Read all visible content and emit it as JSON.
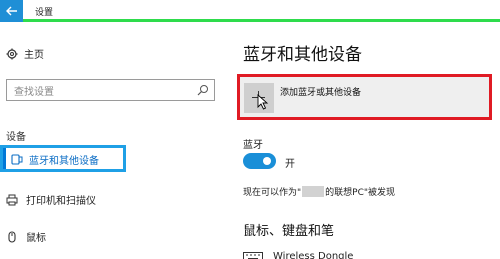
{
  "window": {
    "title": "设置"
  },
  "sidebar": {
    "home_label": "主页",
    "search_placeholder": "查找设置",
    "section_label": "设备",
    "active_item_label": "蓝牙和其他设备",
    "items": [
      {
        "label": "打印机和扫描仪",
        "icon": "printer-icon"
      },
      {
        "label": "鼠标",
        "icon": "mouse-icon"
      }
    ]
  },
  "main": {
    "title": "蓝牙和其他设备",
    "add_device_label": "添加蓝牙或其他设备",
    "bluetooth_label": "蓝牙",
    "toggle_state_label": "开",
    "toggle_on": true,
    "discoverable": {
      "prefix": "现在可以作为\"",
      "suffix": "的联想PC\"被发现"
    },
    "subhead": "鼠标、键盘和笔",
    "device_name": "Wireless Dongle"
  },
  "colors": {
    "accent": "#0078d7",
    "toggle": "#1a8fd8",
    "highlight_blue": "#1fa0e6",
    "highlight_red": "#e01b24",
    "top_rule_green": "#2edc4c"
  }
}
